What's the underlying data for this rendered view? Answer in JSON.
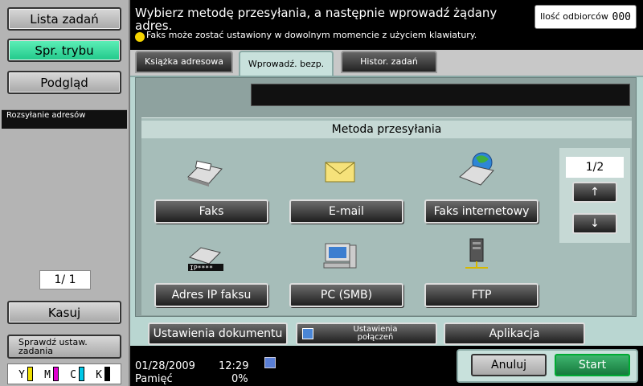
{
  "sidebar": {
    "job_list": "Lista zadań",
    "check_mode": "Spr. trybu",
    "preview": "Podgląd",
    "tab_label": "Rozsyłanie adresów",
    "page_indicator": "1/  1",
    "delete": "Kasuj",
    "check_job": "Sprawdź ustaw. zadania",
    "toner": [
      {
        "label": "Y",
        "color": "#f0e000"
      },
      {
        "label": "M",
        "color": "#e000d0"
      },
      {
        "label": "C",
        "color": "#00c8e8"
      },
      {
        "label": "K",
        "color": "#000000"
      }
    ]
  },
  "header": {
    "instruction": "Wybierz metodę przesyłania, a następnie wprowadź żądany adres.",
    "note": "Faks może zostać ustawiony w dowolnym momencie z użyciem klawiatury.",
    "recipients_label": "Ilość odbiorców",
    "recipients_count": "000"
  },
  "tabs": {
    "address_book": "Książka adresowa",
    "direct_input": "Wprowadź. bezp.",
    "job_history": "Histor. zadań"
  },
  "methods": {
    "title": "Metoda przesyłania",
    "fax": "Faks",
    "email": "E-mail",
    "internet_fax": "Faks internetowy",
    "ip_fax": "Adres IP faksu",
    "pc_smb": "PC (SMB)",
    "ftp": "FTP"
  },
  "pagination": {
    "page": "1/2",
    "up": "↑",
    "down": "↓"
  },
  "bottom_buttons": {
    "doc_settings": "Ustawienia dokumentu",
    "conn_settings": "Ustawienia połączeń",
    "application": "Aplikacja"
  },
  "status": {
    "date": "01/28/2009",
    "time": "12:29",
    "memory_label": "Pamięć",
    "memory_value": "0%"
  },
  "actions": {
    "cancel": "Anuluj",
    "start": "Start"
  }
}
